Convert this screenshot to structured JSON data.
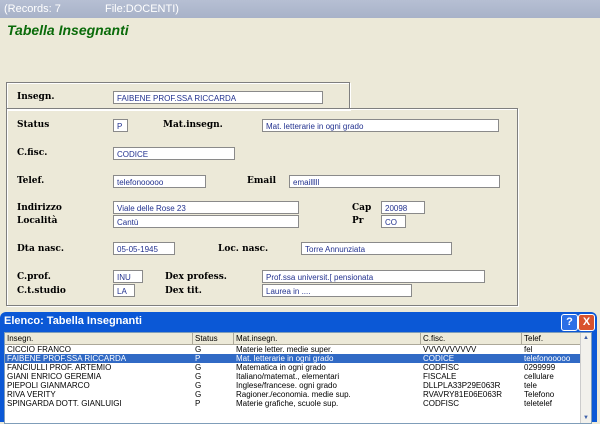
{
  "titlebar": {
    "records": "(Records: 7",
    "file": "File:DOCENTI)"
  },
  "heading": "Tabella Insegnanti",
  "form": {
    "insegn": {
      "label": "Insegn.",
      "value": "FAIBENE PROF.SSA RICCARDA"
    },
    "status": {
      "label": "Status",
      "value": "P"
    },
    "mat_insegn": {
      "label": "Mat.insegn.",
      "value": "Mat. letterarie in ogni grado"
    },
    "cfisc": {
      "label": "C.fisc.",
      "value": "CODICE"
    },
    "telef": {
      "label": "Telef.",
      "value": "telefonooooo"
    },
    "email": {
      "label": "Email",
      "value": "emailllll"
    },
    "indirizzo": {
      "label": "Indirizzo",
      "value": "Viale delle Rose 23"
    },
    "cap": {
      "label": "Cap",
      "value": "20098"
    },
    "localita": {
      "label": "Località",
      "value": "Cantù"
    },
    "pr": {
      "label": "Pr",
      "value": "CO"
    },
    "dta_nasc": {
      "label": "Dta nasc.",
      "value": "05-05-1945"
    },
    "loc_nasc": {
      "label": "Loc. nasc.",
      "value": "Torre Annunziata"
    },
    "cprof": {
      "label": "C.prof.",
      "value": "INU"
    },
    "dex_profess": {
      "label": "Dex profess.",
      "value": "Prof.ssa universit.[ pensionata"
    },
    "ctstudio": {
      "label": "C.t.studio",
      "value": "LA"
    },
    "dex_tit": {
      "label": "Dex tit.",
      "value": "Laurea in ...."
    }
  },
  "list_window": {
    "title": "Elenco: Tabella Insegnanti",
    "help_label": "?",
    "close_label": "X",
    "columns": [
      "Insegn.",
      "Status",
      "Mat.insegn.",
      "C.fisc.",
      "Telef."
    ],
    "rows": [
      [
        "CICCIO FRANCO",
        "G",
        "Materie letter. medie super.",
        "VVVVVVVVVV",
        "fel"
      ],
      [
        "FAIBENE PROF.SSA RICCARDA",
        "P",
        "Mat. letterarie in ogni grado",
        "CODICE",
        "telefonooooo"
      ],
      [
        "FANCIULLI PROF. ARTEMIO",
        "G",
        "Matematica in ogni grado",
        "CODFISC",
        "0299999"
      ],
      [
        "GIANI ENRICO GEREMIA",
        "G",
        "Italiano/matemat., elementari",
        "FISCALE",
        "cellulare"
      ],
      [
        "PIEPOLI GIANMARCO",
        "G",
        "Inglese/francese. ogni grado",
        "DLLPLA33P29E063R",
        "tele"
      ],
      [
        "RIVA VERITY",
        "G",
        "Ragioner./economia. medie sup.",
        "RVAVRY81E06E063R",
        "Telefono"
      ],
      [
        "SPINGARDA DOTT. GIANLUIGI",
        "P",
        "Materie grafiche, scuole sup.",
        "CODFISC",
        "teletelef"
      ]
    ],
    "selected_row": 1
  }
}
